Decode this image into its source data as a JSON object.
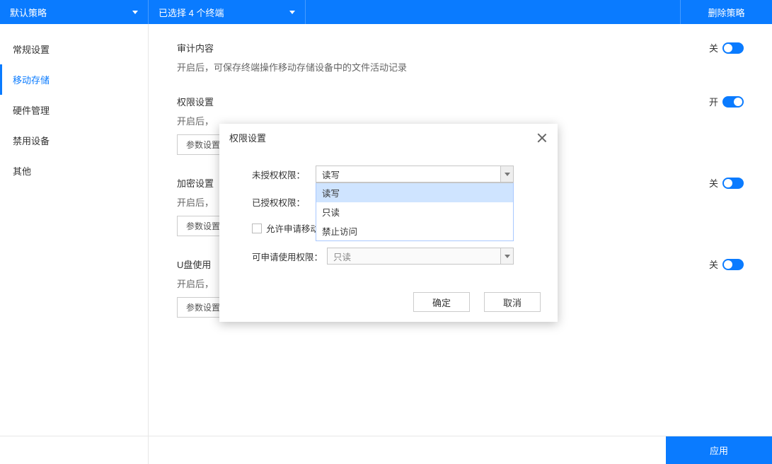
{
  "topbar": {
    "policy_dropdown": "默认策略",
    "terminal_dropdown": "已选择 4 个终端",
    "delete_policy": "删除策略"
  },
  "sidebar": {
    "items": [
      {
        "label": "常规设置"
      },
      {
        "label": "移动存储"
      },
      {
        "label": "硬件管理"
      },
      {
        "label": "禁用设备"
      },
      {
        "label": "其他"
      }
    ],
    "active_index": 1
  },
  "main": {
    "sections": [
      {
        "title": "审计内容",
        "desc": "开启后，可保存终端操作移动存储设备中的文件活动记录",
        "toggle_state": "off",
        "toggle_text": "关",
        "has_param_btn": false
      },
      {
        "title": "权限设置",
        "desc": "开启后，",
        "toggle_state": "on",
        "toggle_text": "开",
        "has_param_btn": true
      },
      {
        "title": "加密设置",
        "desc": "开启后，",
        "toggle_state": "off",
        "toggle_text": "关",
        "has_param_btn": true
      },
      {
        "title": "U盘使用",
        "desc": "开启后，",
        "toggle_state": "off",
        "toggle_text": "关",
        "has_param_btn": true
      }
    ],
    "param_btn_label": "参数设置"
  },
  "footer": {
    "apply": "应用"
  },
  "modal": {
    "title": "权限设置",
    "rows": {
      "unauth_label": "未授权权限：",
      "unauth_value": "读写",
      "auth_label": "已授权权限：",
      "allow_apply_label": "允许申请移动存储使用审批",
      "request_label": "可申请使用权限：",
      "request_value": "只读"
    },
    "dropdown_options": [
      "读写",
      "只读",
      "禁止访问"
    ],
    "dropdown_highlight_index": 0,
    "ok": "确定",
    "cancel": "取消"
  }
}
